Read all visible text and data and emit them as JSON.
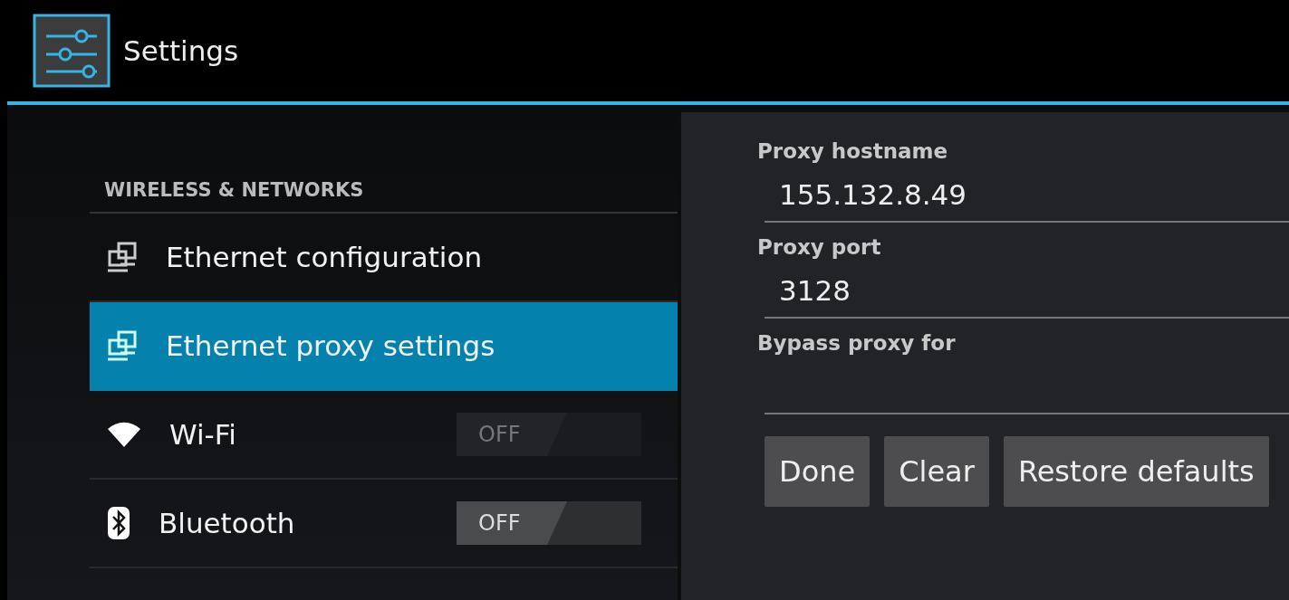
{
  "action_bar": {
    "title": "Settings"
  },
  "sidebar": {
    "section": "WIRELESS & NETWORKS",
    "items": [
      {
        "label": "Ethernet configuration",
        "kind": "link",
        "selected": false
      },
      {
        "label": "Ethernet proxy settings",
        "kind": "link",
        "selected": true
      },
      {
        "label": "Wi-Fi",
        "kind": "toggle",
        "selected": false,
        "toggle": {
          "label": "OFF",
          "on": false,
          "disabled": true
        }
      },
      {
        "label": "Bluetooth",
        "kind": "toggle",
        "selected": false,
        "toggle": {
          "label": "OFF",
          "on": false,
          "disabled": false
        }
      }
    ]
  },
  "dialog": {
    "fields": [
      {
        "label": "Proxy hostname",
        "value": "155.132.8.49"
      },
      {
        "label": "Proxy port",
        "value": "3128"
      },
      {
        "label": "Bypass proxy for"
      }
    ],
    "buttons": [
      "Done",
      "Clear",
      "Restore defaults"
    ]
  }
}
